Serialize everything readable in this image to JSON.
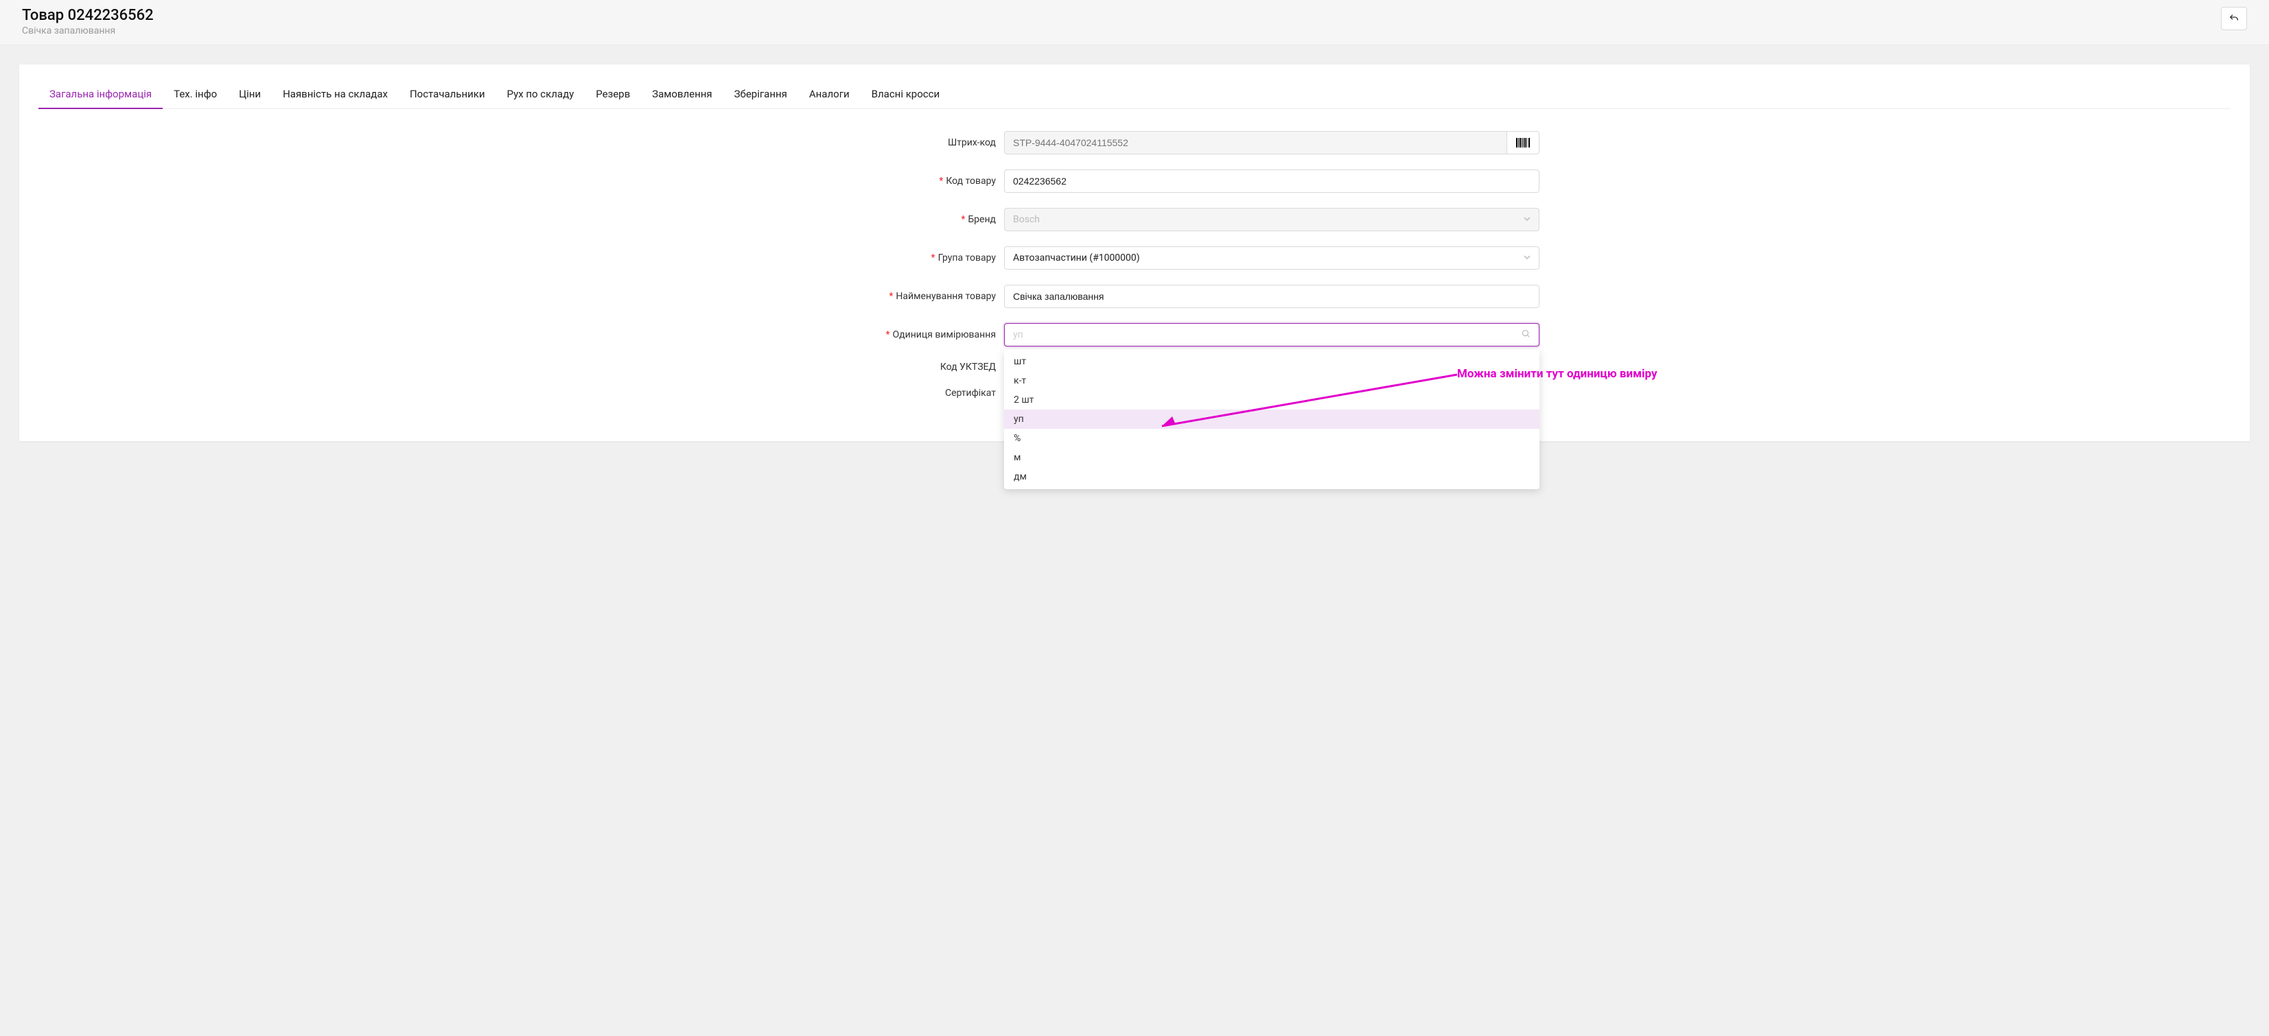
{
  "header": {
    "title": "Товар 0242236562",
    "subtitle": "Свічка запалювання"
  },
  "tabs": [
    {
      "label": "Загальна інформація",
      "active": true
    },
    {
      "label": "Тех. інфо"
    },
    {
      "label": "Ціни"
    },
    {
      "label": "Наявність на складах"
    },
    {
      "label": "Постачальники"
    },
    {
      "label": "Рух по складу"
    },
    {
      "label": "Резерв"
    },
    {
      "label": "Замовлення"
    },
    {
      "label": "Зберігання"
    },
    {
      "label": "Аналоги"
    },
    {
      "label": "Власні кросси"
    }
  ],
  "form": {
    "barcode": {
      "label": "Штрих-код",
      "placeholder": "STP-9444-4047024115552"
    },
    "product_code": {
      "label": "Код товару",
      "value": "0242236562",
      "required": true
    },
    "brand": {
      "label": "Бренд",
      "value": "Bosch",
      "required": true
    },
    "product_group": {
      "label": "Група товару",
      "value": "Автозапчастини (#1000000)",
      "required": true
    },
    "product_name": {
      "label": "Найменування товару",
      "value": "Свічка запалювання",
      "required": true
    },
    "unit": {
      "label": "Одиниця вимірювання",
      "search_placeholder": "уп",
      "required": true
    },
    "uktzed": {
      "label": "Код УКТЗЕД"
    },
    "certificate": {
      "label": "Сертифікат"
    }
  },
  "unit_options": [
    "шт",
    "к-т",
    "2 шт",
    "уп",
    "%",
    "м",
    "дм"
  ],
  "unit_highlight_index": 3,
  "annotation": {
    "text": "Можна змінити тут одиницю виміру"
  }
}
